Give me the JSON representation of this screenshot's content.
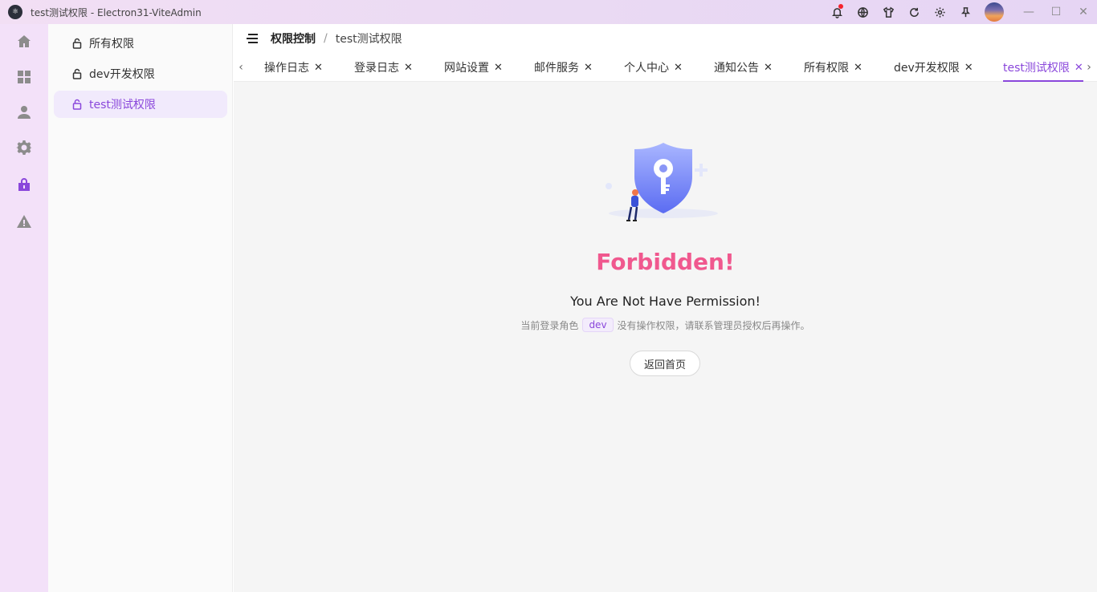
{
  "window": {
    "title": "test测试权限 - Electron31-ViteAdmin"
  },
  "titlebar": {
    "icons": [
      "bell-icon",
      "language-icon",
      "theme-icon",
      "refresh-icon",
      "settings-icon",
      "pin-icon"
    ],
    "controls": [
      "minimize",
      "maximize",
      "close"
    ]
  },
  "rail": {
    "items": [
      "home-icon",
      "dashboard-icon",
      "user-icon",
      "settings-icon",
      "lock-icon",
      "warning-icon"
    ]
  },
  "submenu": {
    "items": [
      {
        "label": "所有权限"
      },
      {
        "label": "dev开发权限"
      },
      {
        "label": "test测试权限"
      }
    ]
  },
  "breadcrumb": {
    "parent": "权限控制",
    "separator": "/",
    "current": "test测试权限"
  },
  "tabs": [
    {
      "label": "操作日志"
    },
    {
      "label": "登录日志"
    },
    {
      "label": "网站设置"
    },
    {
      "label": "邮件服务"
    },
    {
      "label": "个人中心"
    },
    {
      "label": "通知公告"
    },
    {
      "label": "所有权限"
    },
    {
      "label": "dev开发权限"
    },
    {
      "label": "test测试权限"
    }
  ],
  "content": {
    "title": "Forbidden!",
    "subtitle": "You Are Not Have Permission!",
    "desc_prefix": "当前登录角色",
    "role": "dev",
    "desc_suffix": "没有操作权限，请联系管理员授权后再操作。",
    "back_button": "返回首页"
  },
  "colors": {
    "accent": "#8a47db",
    "danger_title": "#f0588e",
    "rail_bg": "#f3e1f9"
  }
}
